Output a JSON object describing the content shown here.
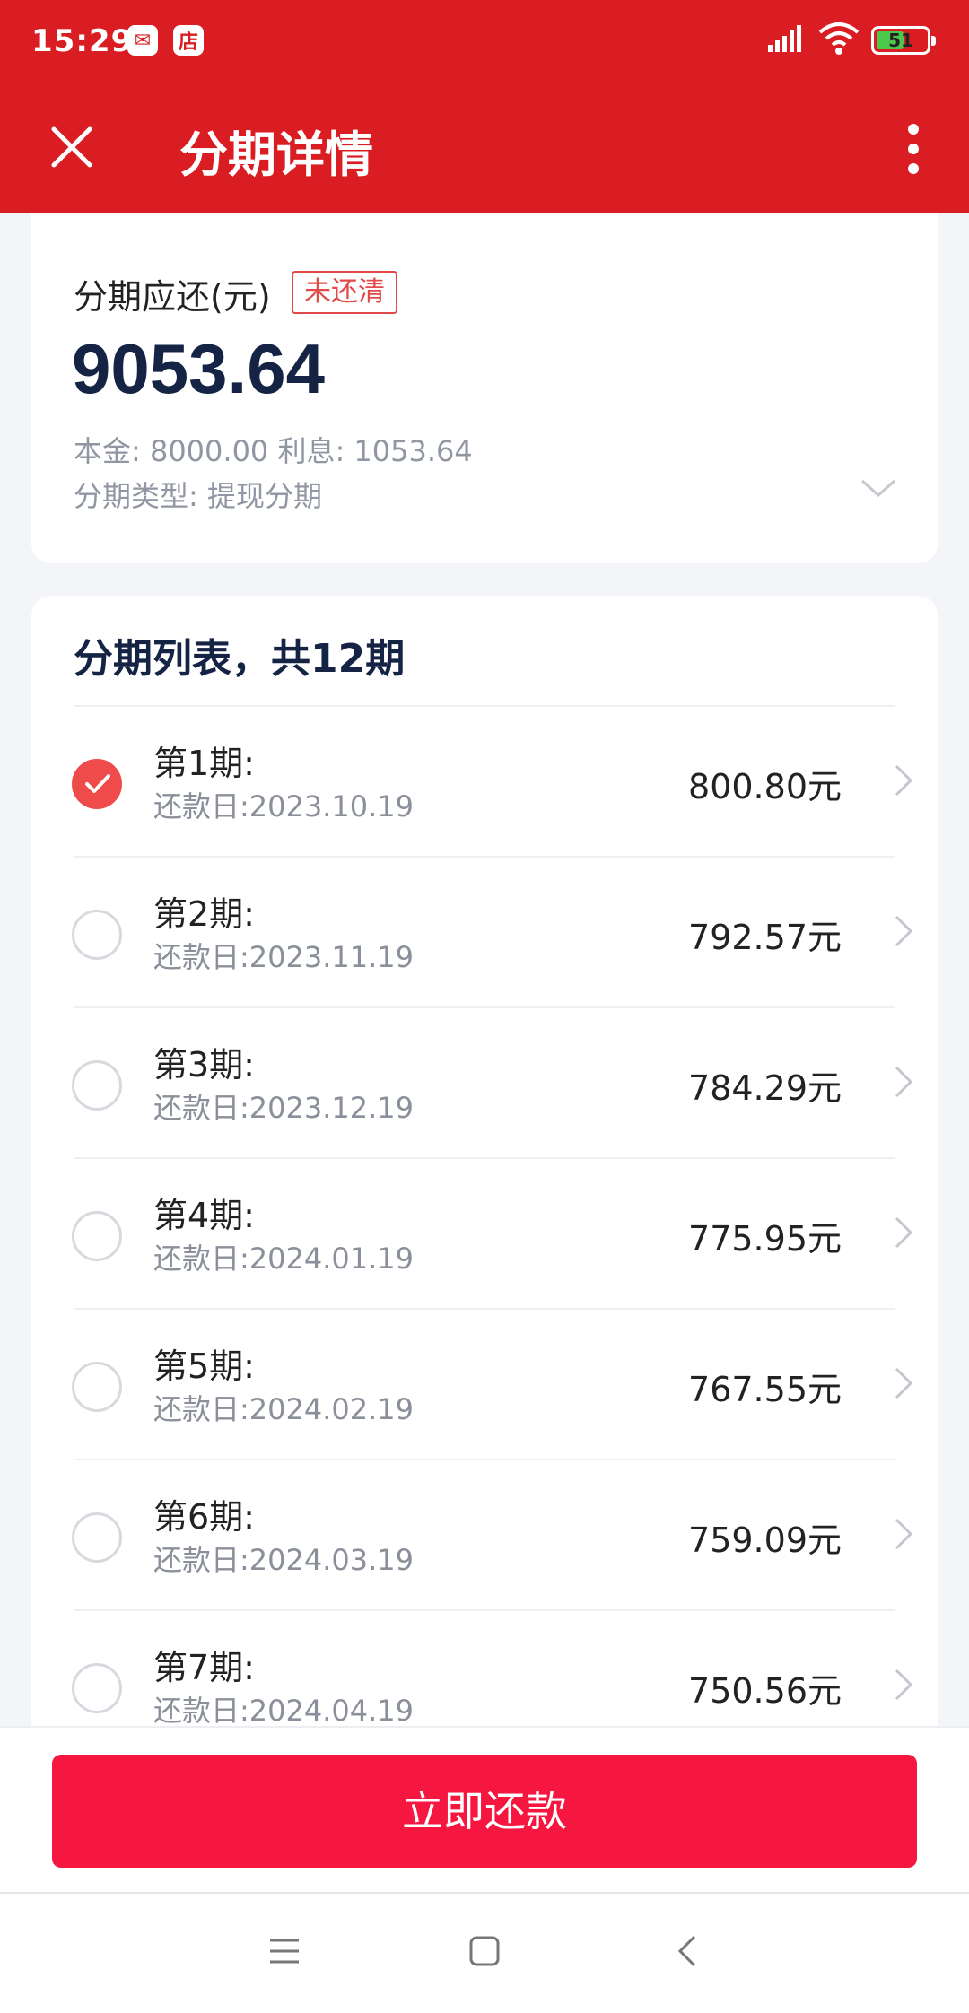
{
  "status_bar": {
    "time": "15:29",
    "app_icon_1": "✉",
    "app_icon_2": "店",
    "battery": "51"
  },
  "header": {
    "title": "分期详情"
  },
  "summary": {
    "label": "分期应还(元)",
    "badge": "未还清",
    "amount": "9053.64",
    "principal_interest": "本金: 8000.00 利息: 1053.64",
    "type": "分期类型: 提现分期"
  },
  "installments": {
    "title": "分期列表，共12期",
    "items": [
      {
        "name": "第1期:",
        "date": "还款日:2023.10.19",
        "amount": "800.80元",
        "checked": true
      },
      {
        "name": "第2期:",
        "date": "还款日:2023.11.19",
        "amount": "792.57元",
        "checked": false
      },
      {
        "name": "第3期:",
        "date": "还款日:2023.12.19",
        "amount": "784.29元",
        "checked": false
      },
      {
        "name": "第4期:",
        "date": "还款日:2024.01.19",
        "amount": "775.95元",
        "checked": false
      },
      {
        "name": "第5期:",
        "date": "还款日:2024.02.19",
        "amount": "767.55元",
        "checked": false
      },
      {
        "name": "第6期:",
        "date": "还款日:2024.03.19",
        "amount": "759.09元",
        "checked": false
      },
      {
        "name": "第7期:",
        "date": "还款日:2024.04.19",
        "amount": "750.56元",
        "checked": false
      }
    ]
  },
  "actions": {
    "pay_now": "立即还款"
  },
  "colors": {
    "brand_red": "#d91d22",
    "button_red": "#f5173f",
    "check_red": "#ef4b4b",
    "amount_navy": "#152345"
  },
  "icons": [
    "close-icon",
    "more-icon",
    "chevron-down-icon",
    "chevron-right-icon",
    "check-icon",
    "menu-icon",
    "home-icon",
    "back-icon",
    "signal-icon",
    "wifi-icon",
    "battery-icon"
  ]
}
